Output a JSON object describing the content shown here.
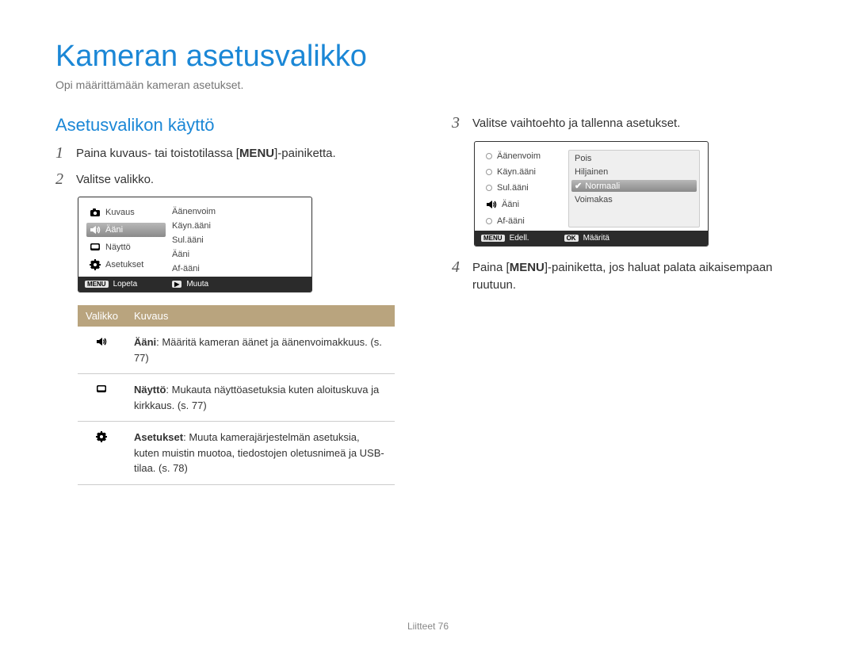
{
  "page_title": "Kameran asetusvalikko",
  "page_subtitle": "Opi määrittämään kameran asetukset.",
  "section_heading": "Asetusvalikon käyttö",
  "steps": {
    "s1_pre": "Paina kuvaus- tai toistotilassa [",
    "s1_key": "MENU",
    "s1_post": "]-painiketta.",
    "s2": "Valitse valikko.",
    "s3": "Valitse vaihtoehto ja tallenna asetukset.",
    "s4_pre": "Paina [",
    "s4_key": "MENU",
    "s4_post": "]-painiketta, jos haluat palata aikaisempaan ruutuun."
  },
  "fig1": {
    "left": [
      {
        "icon": "camera",
        "label": "Kuvaus",
        "selected": false
      },
      {
        "icon": "sound",
        "label": "Ääni",
        "selected": true
      },
      {
        "icon": "display",
        "label": "Näyttö",
        "selected": false
      },
      {
        "icon": "gear",
        "label": "Asetukset",
        "selected": false
      }
    ],
    "right": [
      "Äänenvoim",
      "Käyn.ääni",
      "Sul.ääni",
      "Ääni",
      "Af-ääni"
    ],
    "status_left_key": "MENU",
    "status_left": "Lopeta",
    "status_right_key": "▶",
    "status_right": "Muuta"
  },
  "fig2": {
    "left": [
      {
        "label": "Äänenvoim",
        "radio": "empty"
      },
      {
        "label": "Käyn.ääni",
        "radio": "empty"
      },
      {
        "label": "Sul.ääni",
        "radio": "empty"
      },
      {
        "label": "Ääni",
        "icon": "sound"
      },
      {
        "label": "Af-ääni",
        "radio": "empty"
      }
    ],
    "right": [
      {
        "label": "Pois",
        "selected": false,
        "checked": false
      },
      {
        "label": "Hiljainen",
        "selected": false,
        "checked": false
      },
      {
        "label": "Normaali",
        "selected": true,
        "checked": true
      },
      {
        "label": "Voimakas",
        "selected": false,
        "checked": false
      }
    ],
    "status_left_key": "MENU",
    "status_left": "Edell.",
    "status_right_key": "OK",
    "status_right": "Määritä"
  },
  "table": {
    "head_menu": "Valikko",
    "head_desc": "Kuvaus",
    "rows": [
      {
        "icon": "sound",
        "title": "Ääni",
        "body": ": Määritä kameran äänet ja äänenvoimakkuus. (s. 77)"
      },
      {
        "icon": "display",
        "title": "Näyttö",
        "body": ": Mukauta näyttöasetuksia kuten aloituskuva ja kirkkaus. (s. 77)"
      },
      {
        "icon": "gear",
        "title": "Asetukset",
        "body": ": Muuta kamerajärjestelmän asetuksia, kuten muistin muotoa, tiedostojen oletusnimeä ja USB-tilaa. (s. 78)"
      }
    ]
  },
  "footer_section": "Liitteet",
  "footer_page": "76",
  "icons": {
    "camera": "camera-icon",
    "sound": "sound-icon",
    "display": "display-icon",
    "gear": "gear-icon"
  }
}
